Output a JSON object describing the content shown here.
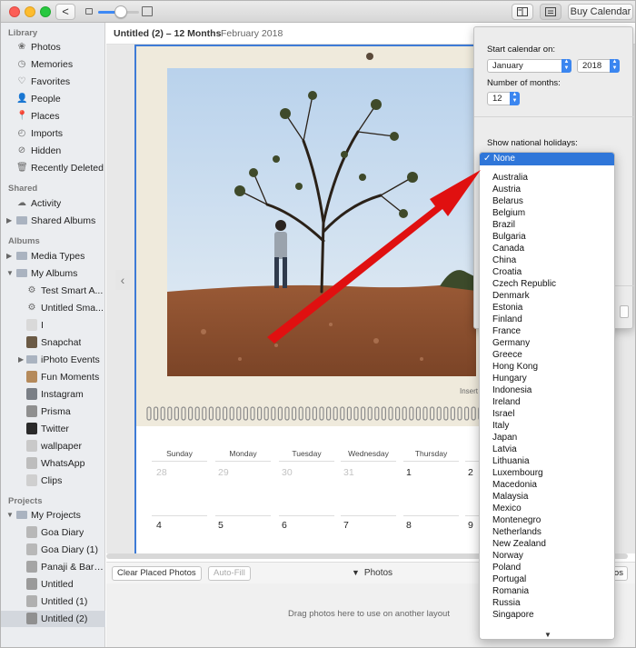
{
  "toolbar": {
    "back_label": "<",
    "buy_label": "Buy Calendar"
  },
  "sidebar": {
    "library_head": "Library",
    "library": [
      {
        "label": "Photos"
      },
      {
        "label": "Memories"
      },
      {
        "label": "Favorites"
      },
      {
        "label": "People"
      },
      {
        "label": "Places"
      },
      {
        "label": "Imports"
      },
      {
        "label": "Hidden"
      },
      {
        "label": "Recently Deleted"
      }
    ],
    "shared_head": "Shared",
    "shared": [
      {
        "label": "Activity"
      },
      {
        "label": "Shared Albums"
      }
    ],
    "albums_head": "Albums",
    "albums": [
      {
        "label": "Media Types"
      },
      {
        "label": "My Albums"
      },
      {
        "label": "Test Smart A..."
      },
      {
        "label": "Untitled Sma..."
      },
      {
        "label": "I"
      },
      {
        "label": "Snapchat"
      },
      {
        "label": "iPhoto Events"
      },
      {
        "label": "Fun Moments"
      },
      {
        "label": "Instagram"
      },
      {
        "label": "Prisma"
      },
      {
        "label": "Twitter"
      },
      {
        "label": "wallpaper"
      },
      {
        "label": "WhatsApp"
      },
      {
        "label": "Clips"
      }
    ],
    "projects_head": "Projects",
    "projects": [
      {
        "label": "My Projects"
      },
      {
        "label": "Goa Diary"
      },
      {
        "label": "Goa Diary (1)"
      },
      {
        "label": "Panaji & Bard..."
      },
      {
        "label": "Untitled"
      },
      {
        "label": "Untitled (1)"
      },
      {
        "label": "Untitled (2)"
      }
    ]
  },
  "main": {
    "title": "Untitled (2) – 12 Months",
    "date": "February 2018",
    "insert_label": "Insert"
  },
  "calendar": {
    "weekdays": [
      "Sunday",
      "Monday",
      "Tuesday",
      "Wednesday",
      "Thursday"
    ],
    "row1": [
      "28",
      "29",
      "30",
      "31",
      "1",
      "2"
    ],
    "row2": [
      "4",
      "5",
      "6",
      "7",
      "8",
      "9"
    ]
  },
  "bottom": {
    "clear_label": "Clear Placed Photos",
    "autofill_label": "Auto-Fill",
    "photos_label": "Photos",
    "photos_right": "otos",
    "drop_text": "Drag photos here to use on another layout"
  },
  "popover": {
    "start_label": "Start calendar on:",
    "month_value": "January",
    "year_value": "2018",
    "months_label": "Number of months:",
    "months_value": "12",
    "holidays_label": "Show national holidays:"
  },
  "dropdown": {
    "selected": "None",
    "check": "✓",
    "items": [
      "Australia",
      "Austria",
      "Belarus",
      "Belgium",
      "Brazil",
      "Bulgaria",
      "Canada",
      "China",
      "Croatia",
      "Czech Republic",
      "Denmark",
      "Estonia",
      "Finland",
      "France",
      "Germany",
      "Greece",
      "Hong Kong",
      "Hungary",
      "Indonesia",
      "Ireland",
      "Israel",
      "Italy",
      "Japan",
      "Latvia",
      "Lithuania",
      "Luxembourg",
      "Macedonia",
      "Malaysia",
      "Mexico",
      "Montenegro",
      "Netherlands",
      "New Zealand",
      "Norway",
      "Poland",
      "Portugal",
      "Romania",
      "Russia",
      "Singapore"
    ]
  },
  "colors": {
    "accent": "#3e7bd6",
    "selection": "#2f76d9",
    "arrow": "#e01010"
  }
}
